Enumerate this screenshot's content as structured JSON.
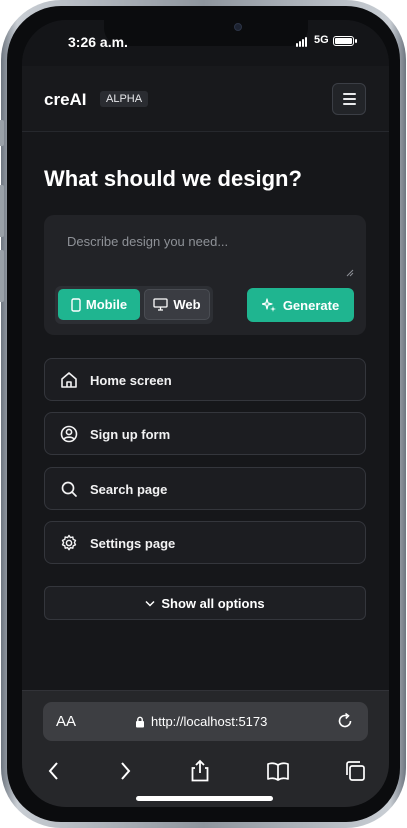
{
  "status_bar": {
    "time": "3:26 a.m.",
    "network": "5G"
  },
  "header": {
    "brand": "creAI",
    "badge": "ALPHA"
  },
  "main": {
    "title": "What should we design?",
    "prompt_placeholder": "Describe design you need...",
    "device_toggle": {
      "mobile_label": "Mobile",
      "web_label": "Web",
      "selected": "Mobile"
    },
    "generate_label": "Generate",
    "options": [
      {
        "label": "Home screen",
        "icon": "home-icon"
      },
      {
        "label": "Sign up form",
        "icon": "user-circle-icon"
      },
      {
        "label": "Search page",
        "icon": "search-icon"
      },
      {
        "label": "Settings page",
        "icon": "gear-icon"
      }
    ],
    "show_all_label": "Show all options"
  },
  "browser": {
    "text_size_label": "AA",
    "url": "http://localhost:5173"
  },
  "colors": {
    "accent": "#1fb590",
    "background": "#16171a",
    "card": "#222327"
  }
}
